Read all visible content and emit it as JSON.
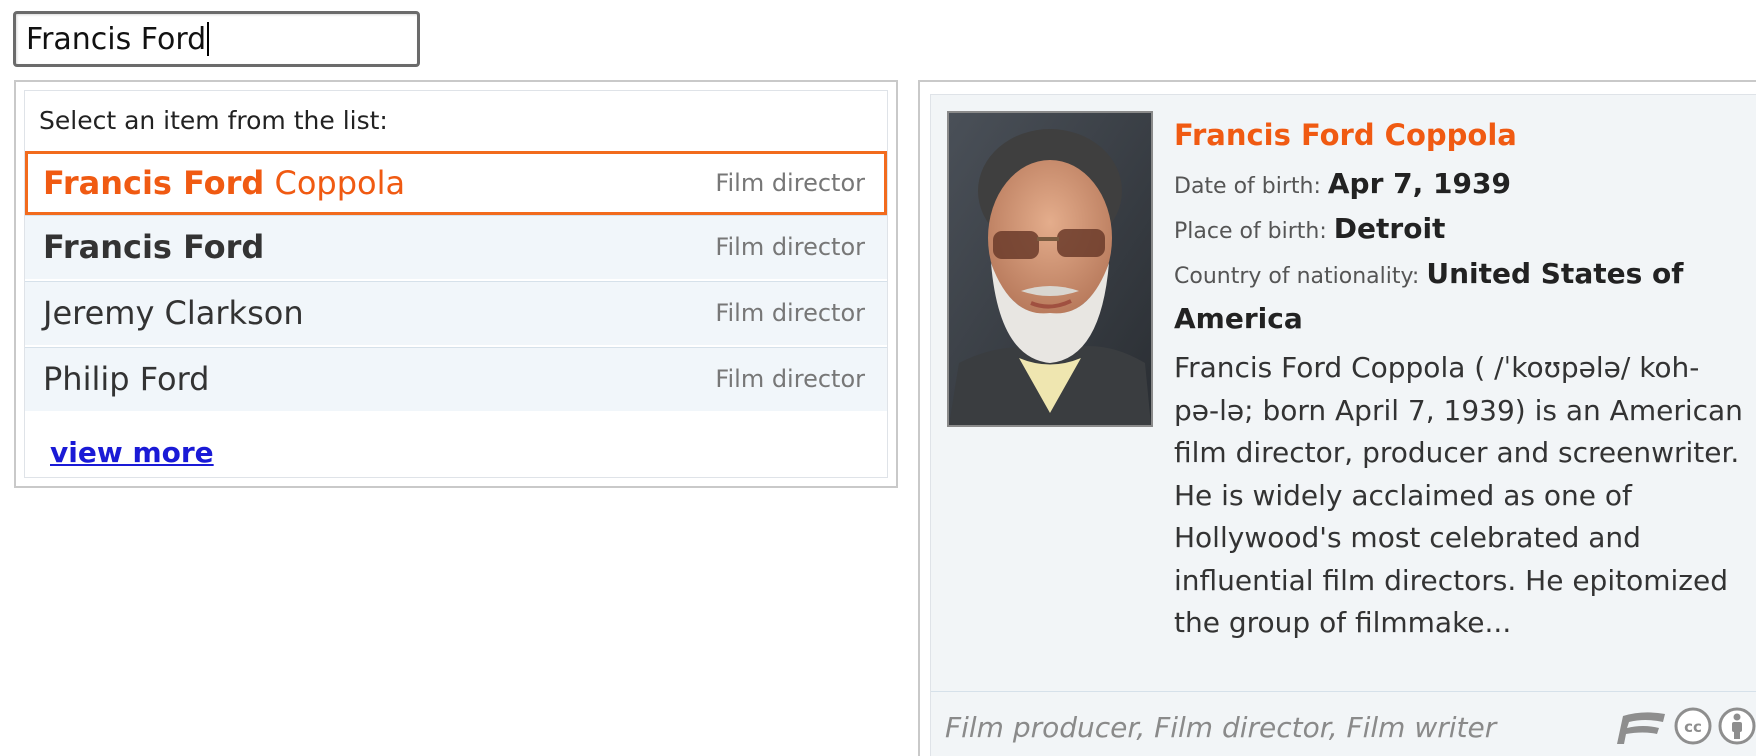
{
  "search": {
    "value": "Francis Ford"
  },
  "suggestions": {
    "header": "Select an item from the list:",
    "items": [
      {
        "match": "Francis Ford",
        "rest": " Coppola",
        "type": "Film director",
        "selected": true
      },
      {
        "match": "Francis Ford",
        "rest": "",
        "type": "Film director",
        "selected": false
      },
      {
        "match": "",
        "rest": "Jeremy Clarkson",
        "type": "Film director",
        "selected": false
      },
      {
        "match": "",
        "rest": "Philip Ford",
        "type": "Film director",
        "selected": false
      }
    ],
    "view_more": "view more"
  },
  "flyout": {
    "name": "Francis Ford Coppola",
    "properties": [
      {
        "label": "Date of birth:",
        "value": "Apr 7, 1939"
      },
      {
        "label": "Place of birth:",
        "value": "Detroit"
      },
      {
        "label": "Country of nationality:",
        "value": "United States of America"
      }
    ],
    "description": "Francis Ford Coppola ( /ˈkoʊpələ/ koh-pə-lə; born April 7, 1939) is an American film director, producer and screenwriter. He is widely acclaimed as one of Hollywood's most celebrated and influential film directors. He epitomized the group of filmmake...",
    "footer_types": "Film producer, Film director, Film writer",
    "footer_icons": [
      "freebase-logo-icon",
      "creative-commons-icon",
      "attribution-icon"
    ]
  },
  "colors": {
    "accent": "#f05a12",
    "link": "#1a1ad6",
    "item_bg": "#f1f6fa",
    "panel_bg": "#f2f5f7"
  }
}
